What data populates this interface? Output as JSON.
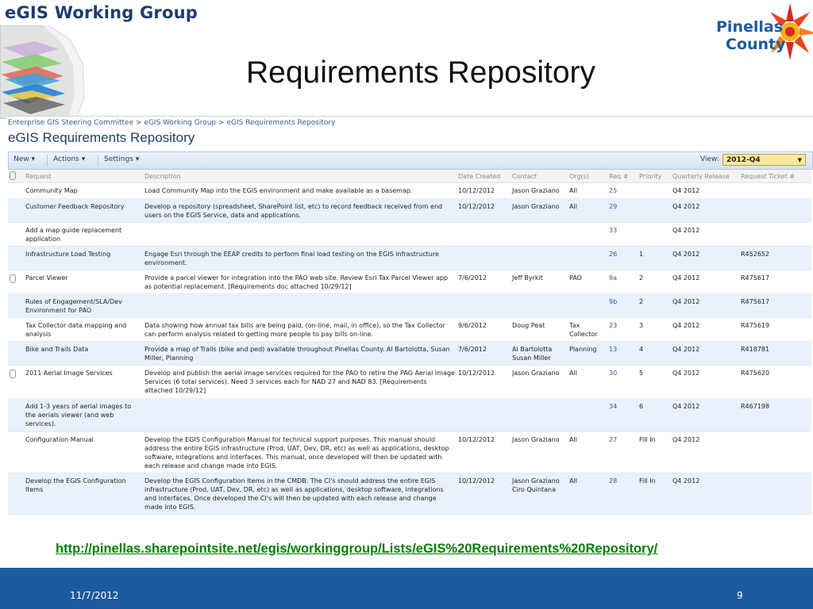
{
  "header": {
    "group_title": "eGIS Working Group",
    "slide_title": "Requirements Repository",
    "logo_line1": "Pinellas",
    "logo_line2": "County"
  },
  "sharepoint": {
    "breadcrumb": [
      "Enterprise GIS Steering Committee",
      "eGIS Working Group",
      "eGIS Requirements Repository"
    ],
    "breadcrumb_sep": ">",
    "list_title": "eGIS Requirements Repository",
    "toolbar": {
      "new_label": "New",
      "actions_label": "Actions",
      "settings_label": "Settings",
      "view_label": "View:",
      "view_value": "2012-Q4"
    },
    "columns": [
      "Request",
      "Description",
      "Date Created",
      "Contact",
      "Org(s)",
      "Req #",
      "Priority",
      "Quarterly Release",
      "Request Ticket #"
    ],
    "rows": [
      {
        "attach": false,
        "request": "Community Map",
        "description": "Load Community Map into the EGIS environment and make available as a basemap.",
        "date": "10/12/2012",
        "contact": "Jason Graziano",
        "org": "All",
        "req": "25",
        "priority": "",
        "release": "Q4 2012",
        "ticket": ""
      },
      {
        "attach": false,
        "request": "Customer Feedback Repository",
        "description": "Develop a repository (spreadsheet, SharePoint list, etc) to record feedback received from end users on the EGIS Service, data and applications.",
        "date": "10/12/2012",
        "contact": "Jason Graziano",
        "org": "All",
        "req": "29",
        "priority": "",
        "release": "Q4 2012",
        "ticket": ""
      },
      {
        "attach": false,
        "request": "Add a map guide replacement application",
        "description": "",
        "date": "",
        "contact": "",
        "org": "",
        "req": "33",
        "priority": "",
        "release": "Q4 2012",
        "ticket": ""
      },
      {
        "attach": false,
        "request": "Infrastructure Load Testing",
        "description": "Engage Esri through the EEAP credits to perform final load testing on the EGIS infrastructure environment.",
        "date": "",
        "contact": "",
        "org": "",
        "req": "26",
        "priority": "1",
        "release": "Q4 2012",
        "ticket": "R452652"
      },
      {
        "attach": true,
        "request": "Parcel Viewer",
        "description": "Provide a parcel viewer for integration into the PAO web site. Review Esri Tax Parcel Viewer app as potential replacement. [Requirements doc attached 10/29/12]",
        "date": "7/6/2012",
        "contact": "Jeff Byrkit",
        "org": "PAO",
        "req": "9a",
        "priority": "2",
        "release": "Q4 2012",
        "ticket": "R475617"
      },
      {
        "attach": false,
        "request": "Rules of Engagement/SLA/Dev Environment for PAO",
        "description": "",
        "date": "",
        "contact": "",
        "org": "",
        "req": "9b",
        "priority": "2",
        "release": "Q4 2012",
        "ticket": "R475617"
      },
      {
        "attach": false,
        "request": "Tax Collector data mapping and analysis",
        "description": "Data showing how annual tax bills are being paid, (on-line, mail, in office), so the Tax Collector can perform analysis related to getting more people to pay bills on-line.",
        "date": "9/6/2012",
        "contact": "Doug Peat",
        "org": "Tax Collector",
        "req": "23",
        "priority": "3",
        "release": "Q4 2012",
        "ticket": "R475619"
      },
      {
        "attach": false,
        "request": "Bike and Trails Data",
        "description": "Provide a map of Trails (bike and ped) available throughout Pinellas County. Al Bartolotta, Susan Miller, Planning",
        "date": "7/6/2012",
        "contact": "Al Bartolotta Susan Miller",
        "org": "Planning",
        "req": "13",
        "priority": "4",
        "release": "Q4 2012",
        "ticket": "R418781"
      },
      {
        "attach": true,
        "request": "2011 Aerial Image Services",
        "description": "Develop and publish the aerial image services required for the PAO to retire the PAO Aerial Image Services (6 total services). Need 3 services each for NAD 27 and NAD 83. [Requirements attached 10/29/12]",
        "date": "10/12/2012",
        "contact": "Jason Graziano",
        "org": "All",
        "req": "30",
        "priority": "5",
        "release": "Q4 2012",
        "ticket": "R475620"
      },
      {
        "attach": false,
        "request": "Add 1-3 years of aerial images to the aerials viewer (and web services).",
        "description": "",
        "date": "",
        "contact": "",
        "org": "",
        "req": "34",
        "priority": "6",
        "release": "Q4 2012",
        "ticket": "R467198"
      },
      {
        "attach": false,
        "request": "Configuration Manual",
        "description": "Develop the EGIS Configuration Manual for technical support purposes. This manual should address the entire EGIS infrastructure (Prod, UAT, Dev, DR, etc) as well as applications, desktop software, integrations and interfaces. This manual, once developed will then be updated with each release and change made into EGIS.",
        "date": "10/12/2012",
        "contact": "Jason Graziano",
        "org": "All",
        "req": "27",
        "priority": "Fill In",
        "release": "Q4 2012",
        "ticket": ""
      },
      {
        "attach": false,
        "request": "Develop the EGIS Configuration Items",
        "description": "Develop the EGIS Configuration Items in the CMDB. The CI's should address the entire EGIS infrastructure (Prod, UAT, Dev, DR, etc) as well as applications, desktop software, integrations and interfaces. Once developed the CI's will then be updated with each release and change made into EGIS.",
        "date": "10/12/2012",
        "contact": "Jason Graziano Ciro Quintana",
        "org": "All",
        "req": "28",
        "priority": "Fill In",
        "release": "Q4 2012",
        "ticket": ""
      }
    ]
  },
  "url": "http://pinellas.sharepointsite.net/egis/workinggroup/Lists/eGIS%20Requirements%20Repository/",
  "footer": {
    "date": "11/7/2012",
    "page": "9"
  },
  "colors": {
    "footer_bg": "#1c5b9e",
    "title_navy": "#1c3d6e",
    "url_green": "#008000",
    "row_alt": "#e9f1fb",
    "view_select": "#fde99b"
  }
}
